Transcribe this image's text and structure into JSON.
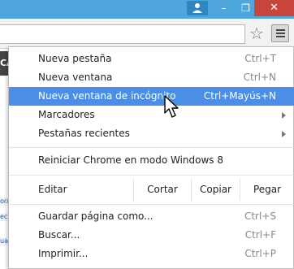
{
  "window": {
    "minimize_glyph": "–",
    "maximize_glyph": "❐",
    "close_glyph": "✕"
  },
  "background_page": {
    "dark_text": "CA",
    "link_1": "ora",
    "link_2": "ec",
    "link_3": "ua"
  },
  "menu": {
    "new_tab": {
      "label": "Nueva pestaña",
      "shortcut": "Ctrl+T"
    },
    "new_window": {
      "label": "Nueva ventana",
      "shortcut": "Ctrl+N"
    },
    "new_incognito": {
      "label": "Nueva ventana de incógnito",
      "shortcut": "Ctrl+Mayús+N"
    },
    "bookmarks": {
      "label": "Marcadores"
    },
    "recent_tabs": {
      "label": "Pestañas recientes"
    },
    "relaunch_win8": {
      "label": "Reiniciar Chrome en modo Windows 8"
    },
    "edit": {
      "label": "Editar",
      "cut": "Cortar",
      "copy": "Copiar",
      "paste": "Pegar"
    },
    "save_page": {
      "label": "Guardar página como...",
      "shortcut": "Ctrl+S"
    },
    "find": {
      "label": "Buscar...",
      "shortcut": "Ctrl+F"
    },
    "print": {
      "label": "Imprimir...",
      "shortcut": "Ctrl+P"
    }
  },
  "colors": {
    "titlebar": "#4fa6dc",
    "close_button": "#c7453a",
    "highlight": "#4a8ee6"
  }
}
